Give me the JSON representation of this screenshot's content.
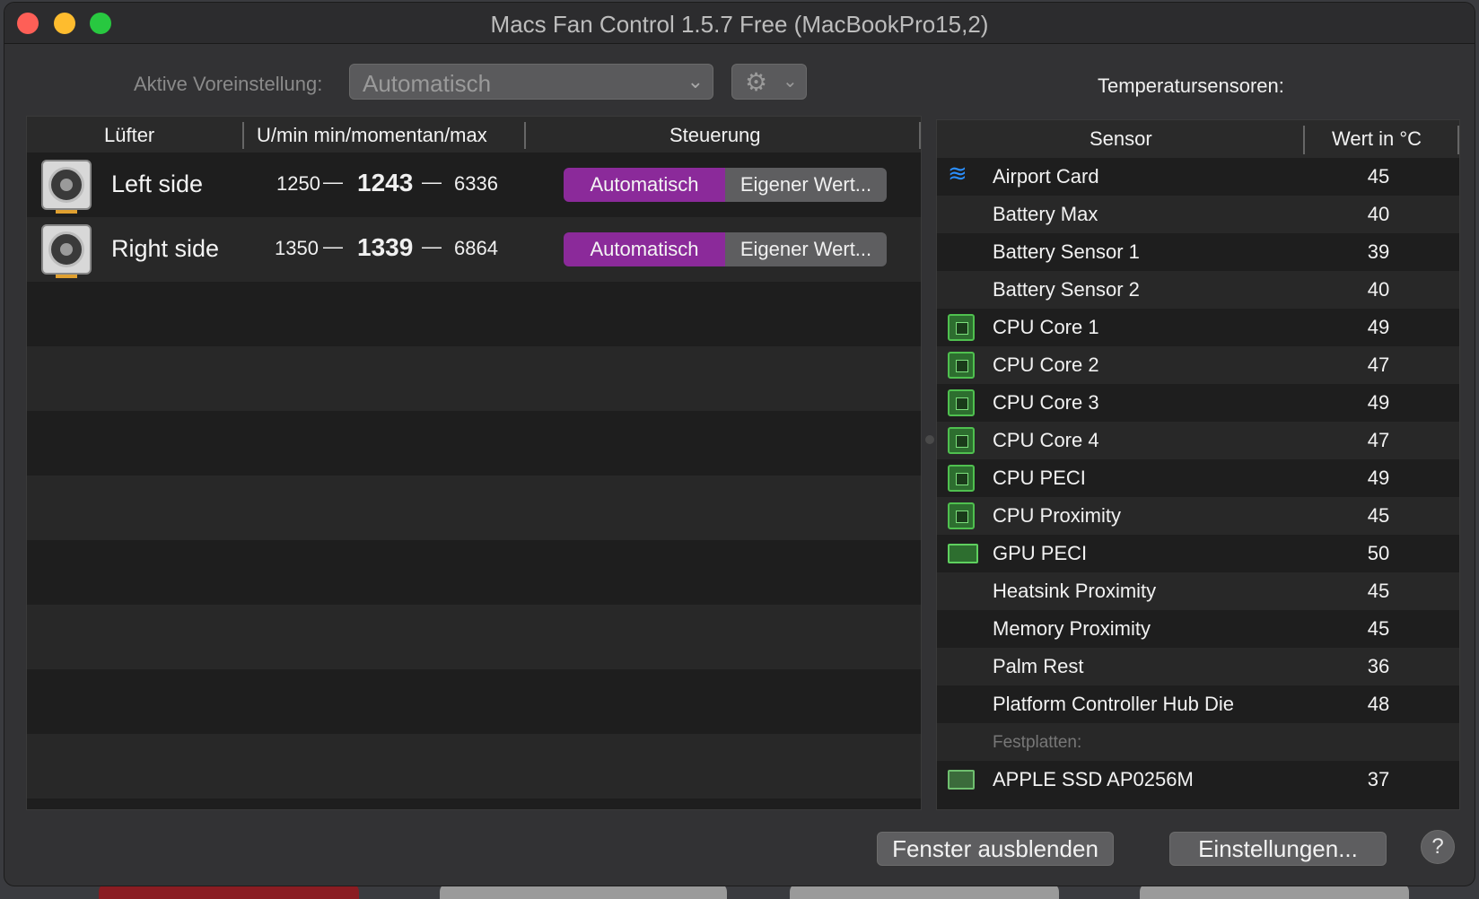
{
  "window": {
    "title": "Macs Fan Control 1.5.7 Free (MacBookPro15,2)"
  },
  "toolbar": {
    "preset_label": "Aktive Voreinstellung:",
    "preset_value": "Automatisch",
    "gear_icon": "gear-icon",
    "chevron_icon": "chevron-down-icon"
  },
  "fans": {
    "columns": [
      "Lüfter",
      "U/min min/momentan/max",
      "Steuerung"
    ],
    "dash": "—",
    "rows": [
      {
        "name": "Left side",
        "min": "1250",
        "current": "1243",
        "max": "6336",
        "auto_label": "Automatisch",
        "custom_label": "Eigener Wert..."
      },
      {
        "name": "Right side",
        "min": "1350",
        "current": "1339",
        "max": "6864",
        "auto_label": "Automatisch",
        "custom_label": "Eigener Wert..."
      }
    ]
  },
  "sensors": {
    "title": "Temperatursensoren:",
    "columns": [
      "Sensor",
      "Wert in °C"
    ],
    "rows": [
      {
        "icon": "wifi-icon",
        "name": "Airport Card",
        "value": "45"
      },
      {
        "icon": "",
        "name": "Battery Max",
        "value": "40"
      },
      {
        "icon": "",
        "name": "Battery Sensor 1",
        "value": "39"
      },
      {
        "icon": "",
        "name": "Battery Sensor 2",
        "value": "40"
      },
      {
        "icon": "cpu-chip-icon",
        "name": "CPU Core 1",
        "value": "49"
      },
      {
        "icon": "cpu-chip-icon",
        "name": "CPU Core 2",
        "value": "47"
      },
      {
        "icon": "cpu-chip-icon",
        "name": "CPU Core 3",
        "value": "49"
      },
      {
        "icon": "cpu-chip-icon",
        "name": "CPU Core 4",
        "value": "47"
      },
      {
        "icon": "cpu-chip-icon",
        "name": "CPU PECI",
        "value": "49"
      },
      {
        "icon": "cpu-chip-icon",
        "name": "CPU Proximity",
        "value": "45"
      },
      {
        "icon": "gpu-card-icon",
        "name": "GPU PECI",
        "value": "50"
      },
      {
        "icon": "",
        "name": "Heatsink Proximity",
        "value": "45"
      },
      {
        "icon": "",
        "name": "Memory Proximity",
        "value": "45"
      },
      {
        "icon": "",
        "name": "Palm Rest",
        "value": "36"
      },
      {
        "icon": "",
        "name": "Platform Controller Hub Die",
        "value": "48"
      }
    ],
    "group_label": "Festplatten:",
    "disks": [
      {
        "icon": "ssd-icon",
        "name": "APPLE SSD AP0256M",
        "value": "37"
      }
    ]
  },
  "footer": {
    "hide_label": "Fenster ausblenden",
    "settings_label": "Einstellungen...",
    "help_label": "?"
  },
  "colors": {
    "accent_purple": "#8b2a9a",
    "chip_green": "#4fc04f",
    "wifi_blue": "#2b8fff"
  }
}
